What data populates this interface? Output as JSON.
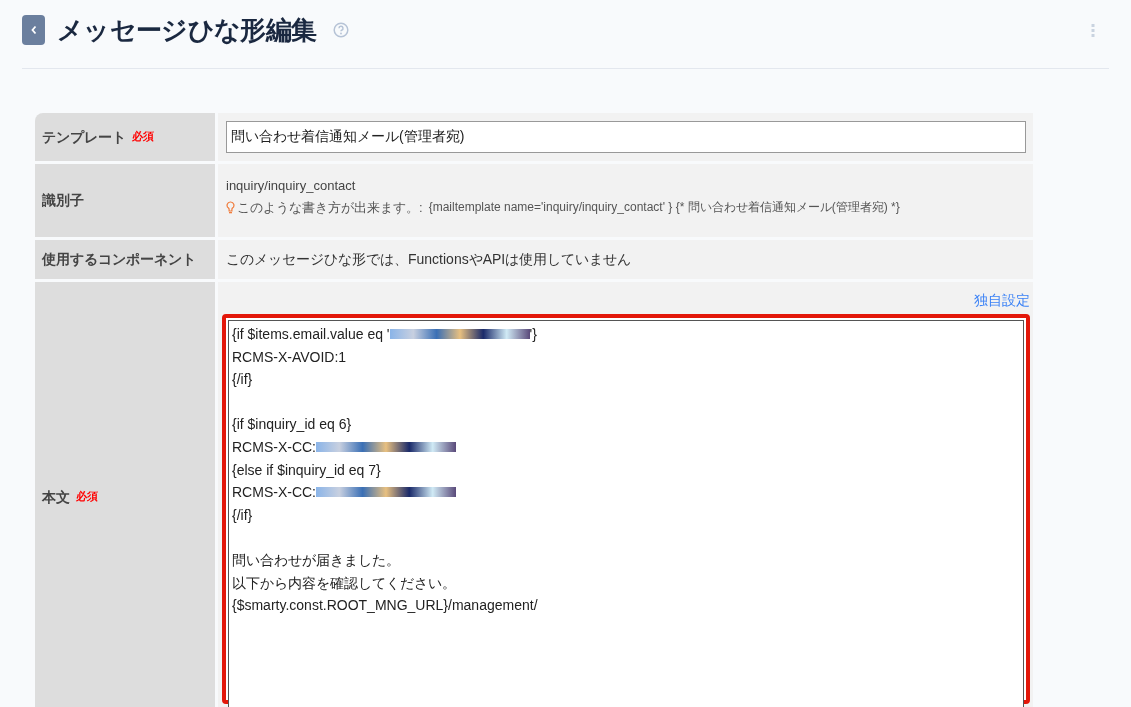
{
  "header": {
    "title": "メッセージひな形編集"
  },
  "form": [
    {
      "kind": "input",
      "label": "テンプレート",
      "required": true,
      "required_label": "必須",
      "value": "問い合わせ着信通知メール(管理者宛)"
    },
    {
      "kind": "identifier",
      "label": "識別子",
      "value": "inquiry/inquiry_contact",
      "hint_lead": "このような書き方が出来ます。:",
      "hint_code": "{mailtemplate name='inquiry/inquiry_contact' } {* 問い合わせ着信通知メール(管理者宛) *}"
    },
    {
      "kind": "text",
      "label": "使用するコンポーネント",
      "value": "このメッセージひな形では、FunctionsやAPIは使用していません"
    },
    {
      "kind": "editor",
      "label": "本文",
      "required": true,
      "required_label": "必須",
      "link": "独自設定",
      "highlighted": true,
      "lines": [
        [
          {
            "kind": "text",
            "text": "{if $items.email.value eq '"
          },
          {
            "kind": "redacted"
          },
          {
            "kind": "text",
            "text": "'}"
          }
        ],
        [
          {
            "kind": "text",
            "text": "RCMS-X-AVOID:1"
          }
        ],
        [
          {
            "kind": "text",
            "text": "{/if}"
          }
        ],
        [
          {
            "kind": "blank"
          }
        ],
        [
          {
            "kind": "text",
            "text": "{if $inquiry_id eq 6}"
          }
        ],
        [
          {
            "kind": "text",
            "text": "RCMS-X-CC:"
          },
          {
            "kind": "redacted"
          }
        ],
        [
          {
            "kind": "text",
            "text": "{else if $inquiry_id eq 7}"
          }
        ],
        [
          {
            "kind": "text",
            "text": "RCMS-X-CC:"
          },
          {
            "kind": "redacted"
          }
        ],
        [
          {
            "kind": "text",
            "text": "{/if}"
          }
        ],
        [
          {
            "kind": "blank"
          }
        ],
        [
          {
            "kind": "text",
            "text": "問い合わせが届きました。"
          }
        ],
        [
          {
            "kind": "text",
            "text": "以下から内容を確認してください。"
          }
        ],
        [
          {
            "kind": "text",
            "text": "{$smarty.const.ROOT_MNG_URL}/management/"
          }
        ]
      ]
    }
  ]
}
